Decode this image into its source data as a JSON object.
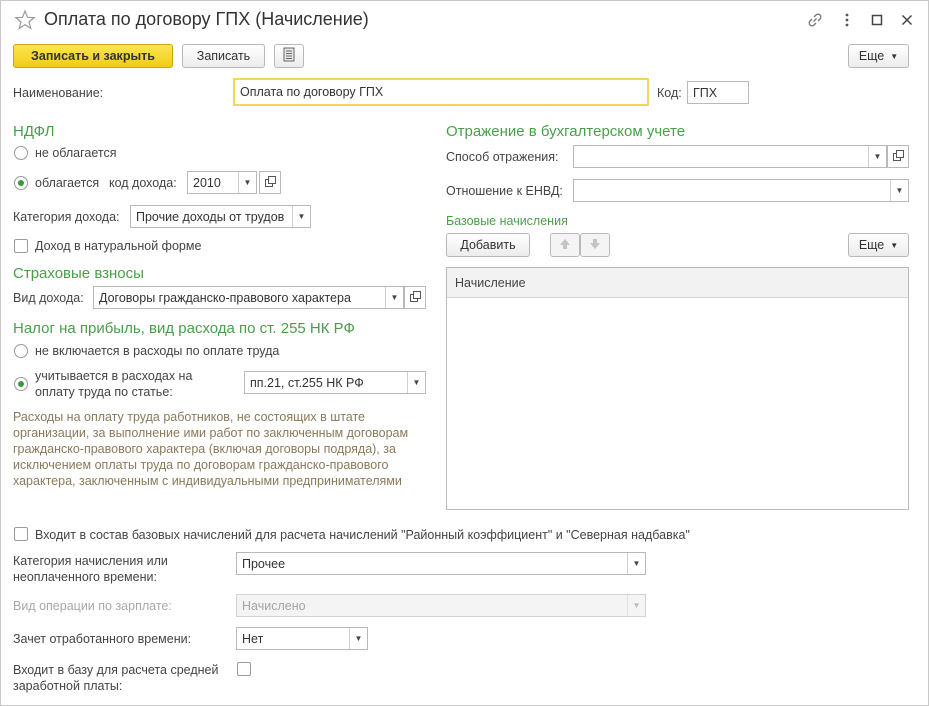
{
  "window": {
    "title": "Оплата по договору ГПХ (Начисление)"
  },
  "toolbar": {
    "save_close_label": "Записать и закрыть",
    "save_label": "Записать",
    "more_label": "Еще"
  },
  "fields": {
    "name_label": "Наименование:",
    "name_value": "Оплата по договору ГПХ",
    "code_label": "Код:",
    "code_value": "ГПХ"
  },
  "ndfl": {
    "header": "НДФЛ",
    "option_not_taxed": "не облагается",
    "option_taxed": "облагается",
    "income_code_label": "код дохода:",
    "income_code_value": "2010",
    "income_category_label": "Категория дохода:",
    "income_category_value": "Прочие доходы от трудов",
    "natural_form_label": "Доход в натуральной форме"
  },
  "insurance": {
    "header": "Страховые взносы",
    "income_type_label": "Вид дохода:",
    "income_type_value": "Договоры гражданско-правового характера"
  },
  "profit_tax": {
    "header": "Налог на прибыль, вид расхода по ст. 255 НК РФ",
    "option_excluded": "не включается в расходы по оплате труда",
    "option_included_line1": "учитывается в расходах на",
    "option_included_line2": "оплату труда по статье:",
    "article_value": "пп.21, ст.255 НК РФ",
    "note": "Расходы на оплату труда работников, не состоящих в штате организации, за выполнение ими работ по заключенным договорам гражданско-правового характера (включая договоры подряда), за исключением оплаты труда по договорам гражданско-правового характера, заключенным с индивидуальными предпринимателями"
  },
  "accounting": {
    "header": "Отражение в бухгалтерском учете",
    "method_label": "Способ отражения:",
    "method_value": "",
    "envd_label": "Отношение к ЕНВД:",
    "envd_value": "",
    "base_header": "Базовые начисления",
    "add_label": "Добавить",
    "more_label": "Еще",
    "table_columns": [
      "Начисление"
    ],
    "table_rows": []
  },
  "bottom": {
    "regional_checkbox_label": "Входит в состав базовых начислений для расчета начислений \"Районный коэффициент\" и \"Северная надбавка\"",
    "category_label_line1": "Категория начисления или",
    "category_label_line2": "неоплаченного времени:",
    "category_value": "Прочее",
    "operation_label": "Вид операции по зарплате:",
    "operation_value": "Начислено",
    "time_credit_label": "Зачет отработанного времени:",
    "time_credit_value": "Нет",
    "avg_base_label_line1": "Входит в базу для расчета средней",
    "avg_base_label_line2": "заработной платы:"
  },
  "colors": {
    "accent_green": "#4a9e4a",
    "primary_button": "#f5d327",
    "note_text": "#8a7a5a"
  },
  "icons": [
    "star-icon",
    "link-icon",
    "more-vertical-icon",
    "maximize-icon",
    "close-icon",
    "report-icon",
    "open-icon",
    "arrow-up-icon",
    "arrow-down-icon",
    "chevron-down-icon"
  ]
}
